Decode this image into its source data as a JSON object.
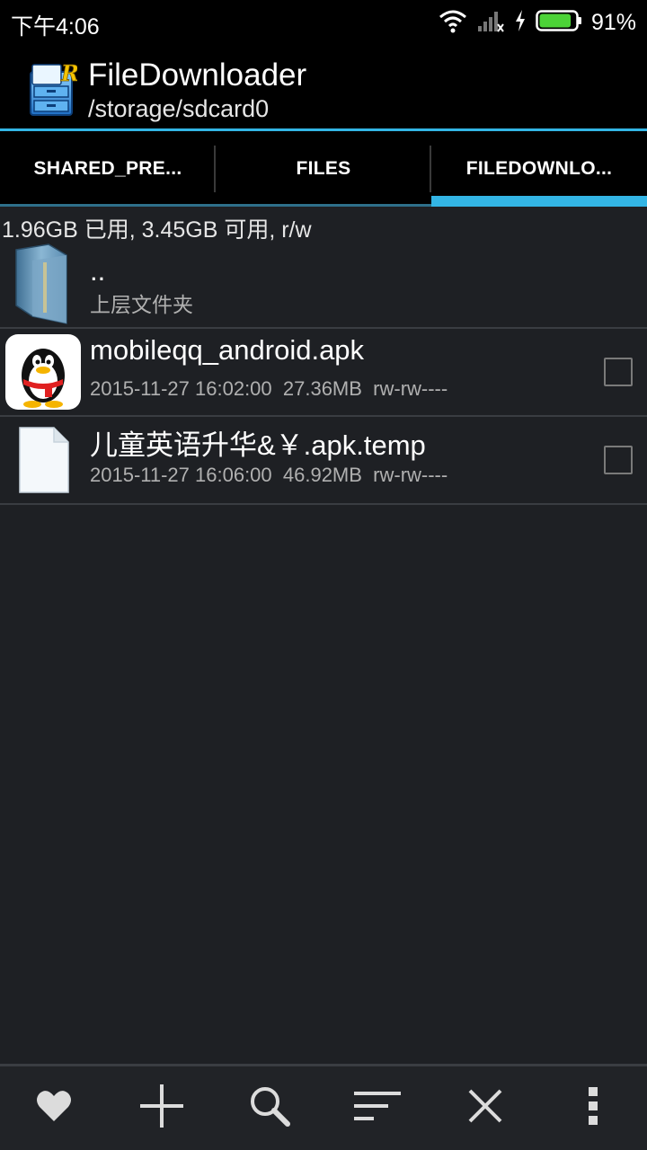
{
  "status_bar": {
    "time": "下午4:06",
    "battery_percent_label": "91%",
    "battery_level": 0.91,
    "icons": [
      "wifi-icon",
      "signal-icon",
      "charging-icon",
      "battery-icon"
    ]
  },
  "header": {
    "app_icon": "root-explorer-app-icon",
    "title": "FileDownloader",
    "path": "/storage/sdcard0"
  },
  "tabs": [
    {
      "label": "SHARED_PRE...",
      "active": false
    },
    {
      "label": "FILES",
      "active": false
    },
    {
      "label": "FILEDOWNLO...",
      "active": true
    }
  ],
  "storage_info": "1.96GB 已用, 3.45GB 可用, r/w",
  "files": [
    {
      "name": "..",
      "meta": "上层文件夹",
      "icon": "folder-icon",
      "checkbox": false
    },
    {
      "name": "mobileqq_android.apk",
      "meta": "2015-11-27 16:02:00  27.36MB  rw-rw----",
      "icon": "qq-penguin-icon",
      "checkbox": true
    },
    {
      "name": "儿童英语升华&￥.apk.temp",
      "meta": "2015-11-27 16:06:00  46.92MB  rw-rw----",
      "icon": "document-icon",
      "checkbox": true
    }
  ],
  "bottom_bar": [
    "heart-icon",
    "add-icon",
    "search-icon",
    "sort-icon",
    "close-icon",
    "overflow-menu-icon"
  ],
  "colors": {
    "accent": "#33b5e5",
    "background": "#1e2024",
    "battery": "#4cd337"
  }
}
